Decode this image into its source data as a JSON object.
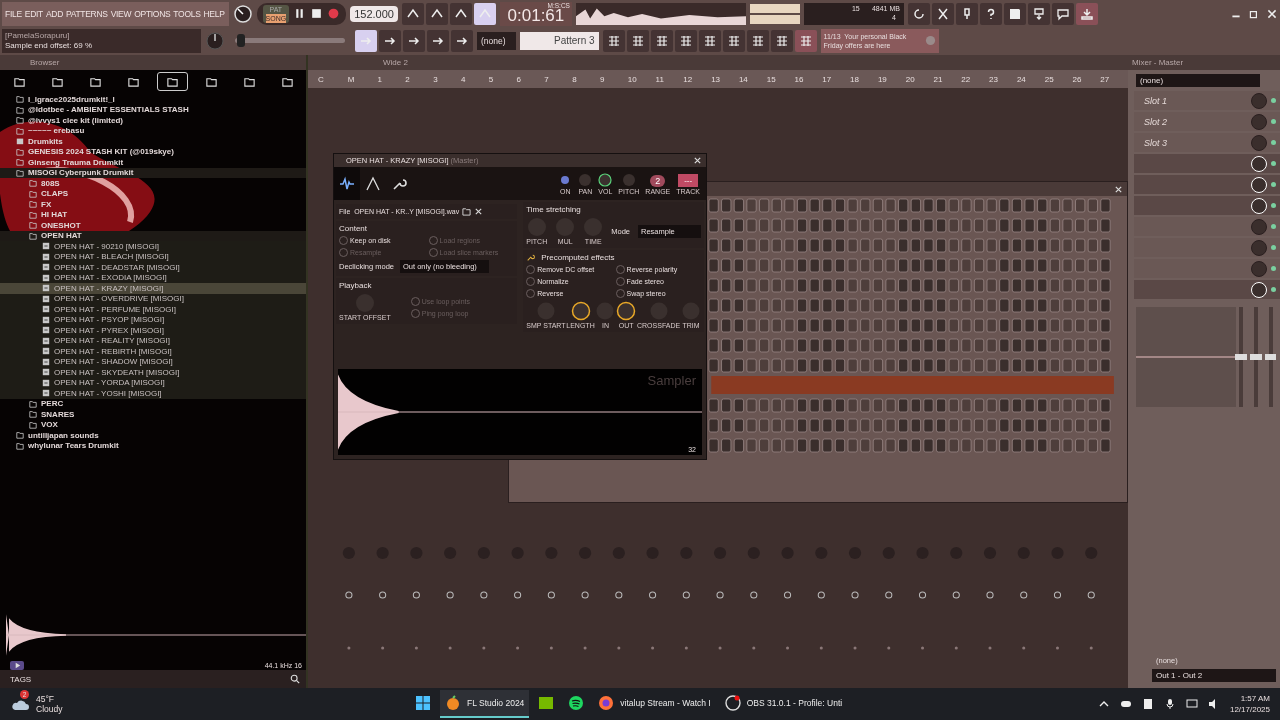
{
  "menu": [
    "FILE",
    "EDIT",
    "ADD",
    "PATTERNS",
    "VIEW",
    "OPTIONS",
    "TOOLS",
    "HELP"
  ],
  "hint_panel": {
    "title": "[PamelaSorapuru]",
    "text": "Sample end offset: 69 %"
  },
  "transport": {
    "pat_label": "PAT",
    "song_label": "SONG",
    "song_selected": true,
    "tempo": "152.000",
    "time": "0:01:61",
    "time_unit": "M:S:CS"
  },
  "position_slider": {
    "level": 0.02
  },
  "cpu": {
    "value": "15",
    "memory": "4841 MB",
    "polyphony": "4"
  },
  "pattern": {
    "preset": "(none)",
    "name": "Pattern 3"
  },
  "news": {
    "counter": "11/13",
    "text": "Your personal Black Friday offers are here"
  },
  "browser": {
    "title": "Browser",
    "tree": [
      {
        "kind": "folder",
        "label": "l_lgrace2025drumkit!_l",
        "expanded": false,
        "selected": false
      },
      {
        "kind": "folder",
        "label": "@ldotbee - AMBIENT ESSENTIALS STASH",
        "expanded": false,
        "selected": false
      },
      {
        "kind": "folder",
        "label": "@ivvys1 clee kit (limited)",
        "expanded": false,
        "selected": false
      },
      {
        "kind": "folder",
        "label": "~~~~~ erebasu",
        "expanded": false,
        "selected": false
      },
      {
        "kind": "pack",
        "label": "Drumkits",
        "expanded": false,
        "selected": false
      },
      {
        "kind": "folder",
        "label": "GENESIS 2024 STASH KIT (@019skye)",
        "expanded": false,
        "selected": false
      },
      {
        "kind": "folder",
        "label": "Ginseng Trauma Drumkit",
        "expanded": false,
        "selected": false
      },
      {
        "kind": "folder",
        "label": "MISOGI Cyberpunk Drumkit",
        "expanded": true,
        "selected": false,
        "children": [
          {
            "kind": "folder",
            "label": "808S",
            "expanded": false,
            "selected": false
          },
          {
            "kind": "folder",
            "label": "CLAPS",
            "expanded": false,
            "selected": false
          },
          {
            "kind": "folder",
            "label": "FX",
            "expanded": false,
            "selected": false
          },
          {
            "kind": "folder",
            "label": "HI HAT",
            "expanded": false,
            "selected": false
          },
          {
            "kind": "folder",
            "label": "ONESHOT",
            "expanded": false,
            "selected": false
          },
          {
            "kind": "folder",
            "label": "OPEN HAT",
            "expanded": true,
            "selected": false,
            "children": [
              {
                "kind": "file",
                "label": "OPEN HAT - 90210 [MISOGI]",
                "selected": false
              },
              {
                "kind": "file",
                "label": "OPEN HAT - BLEACH [MISOGI]",
                "selected": false
              },
              {
                "kind": "file",
                "label": "OPEN HAT - DEADSTAR [MISOGI]",
                "selected": false
              },
              {
                "kind": "file",
                "label": "OPEN HAT - EXODIA [MISOGI]",
                "selected": false
              },
              {
                "kind": "file",
                "label": "OPEN HAT - KRAZY [MISOGI]",
                "selected": true
              },
              {
                "kind": "file",
                "label": "OPEN HAT - OVERDRIVE [MISOGI]",
                "selected": false
              },
              {
                "kind": "file",
                "label": "OPEN HAT - PERFUME [MISOGI]",
                "selected": false
              },
              {
                "kind": "file",
                "label": "OPEN HAT - PSYOP [MISOGI]",
                "selected": false
              },
              {
                "kind": "file",
                "label": "OPEN HAT - PYREX [MISOGI]",
                "selected": false
              },
              {
                "kind": "file",
                "label": "OPEN HAT - REALITY [MISOGI]",
                "selected": false
              },
              {
                "kind": "file",
                "label": "OPEN HAT - REBIRTH [MISOGI]",
                "selected": false
              },
              {
                "kind": "file",
                "label": "OPEN HAT - SHADOW [MISOGI]",
                "selected": false
              },
              {
                "kind": "file",
                "label": "OPEN HAT - SKYDEATH [MISOGI]",
                "selected": false
              },
              {
                "kind": "file",
                "label": "OPEN HAT - YORDA [MISOGI]",
                "selected": false
              },
              {
                "kind": "file",
                "label": "OPEN HAT - YOSHI [MISOGI]",
                "selected": false
              }
            ]
          },
          {
            "kind": "folder",
            "label": "PERC",
            "expanded": false,
            "selected": false
          },
          {
            "kind": "folder",
            "label": "SNARES",
            "expanded": false,
            "selected": false
          },
          {
            "kind": "folder",
            "label": "VOX",
            "expanded": false,
            "selected": false
          }
        ]
      },
      {
        "kind": "folder",
        "label": "untilljapan sounds",
        "expanded": false,
        "selected": false
      },
      {
        "kind": "folder",
        "label": "whylunar Tears Drumkit",
        "expanded": false,
        "selected": false
      }
    ],
    "sample_info": "44.1 kHz 16",
    "tags_label": "TAGS"
  },
  "playlist": {
    "title": "Wide 2",
    "markers": [
      "C",
      "M"
    ],
    "bars": [
      "1",
      "2",
      "3",
      "4",
      "5",
      "6",
      "7",
      "8",
      "9",
      "10",
      "11",
      "12",
      "13",
      "14",
      "15",
      "16",
      "17",
      "18",
      "19",
      "20",
      "21",
      "22",
      "23",
      "24",
      "25",
      "26",
      "27"
    ]
  },
  "sampler": {
    "title": "OPEN HAT - KRAZY [MISOGI]",
    "subtitle": "(Master)",
    "tabs": [
      {
        "kind": "wave",
        "selected": true
      },
      {
        "kind": "envelope",
        "selected": false
      },
      {
        "kind": "wrench",
        "selected": false
      }
    ],
    "top_knobs": [
      {
        "label": "ON",
        "kind": "led"
      },
      {
        "label": "PAN",
        "kind": "knob"
      },
      {
        "label": "VOL",
        "kind": "ring"
      },
      {
        "label": "PITCH",
        "kind": "knob"
      }
    ],
    "range": {
      "label": "RANGE",
      "value": "2"
    },
    "track": {
      "label": "TRACK",
      "value": "---"
    },
    "file": {
      "label": "File",
      "name": "OPEN HAT - KR..Y [MISOGI].wav"
    },
    "content": {
      "title": "Content",
      "options": [
        {
          "label": "Keep on disk",
          "checked": false,
          "disabled": false
        },
        {
          "label": "Load regions",
          "checked": false,
          "disabled": true
        },
        {
          "label": "Resample",
          "checked": false,
          "disabled": true
        },
        {
          "label": "Load slice markers",
          "checked": false,
          "disabled": true
        }
      ],
      "declicking_label": "Declicking mode",
      "declicking_value": "Out only (no bleeding)"
    },
    "playback": {
      "title": "Playback",
      "knob": "START OFFSET",
      "options": [
        {
          "label": "Use loop points",
          "checked": false,
          "disabled": true
        },
        {
          "label": "Ping pong loop",
          "checked": false,
          "disabled": true
        }
      ]
    },
    "time_stretching": {
      "title": "Time stretching",
      "knobs": [
        "PITCH",
        "MUL",
        "TIME"
      ],
      "mode_label": "Mode",
      "mode_value": "Resample"
    },
    "effects": {
      "title": "Precomputed effects",
      "options": [
        {
          "label": "Remove DC offset",
          "checked": false
        },
        {
          "label": "Reverse polarity",
          "checked": false
        },
        {
          "label": "Normalize",
          "checked": false
        },
        {
          "label": "Fade stereo",
          "checked": false
        },
        {
          "label": "Reverse",
          "checked": false
        },
        {
          "label": "Swap stereo",
          "checked": false
        }
      ]
    },
    "envelope_knobs": [
      {
        "label": "SMP START",
        "active": false
      },
      {
        "label": "LENGTH",
        "active": true
      },
      {
        "label": "IN",
        "active": false
      },
      {
        "label": "OUT",
        "active": true
      },
      {
        "label": "CROSSFADE",
        "active": false
      },
      {
        "label": "TRIM",
        "active": false
      }
    ],
    "plugin_name": "Sampler",
    "zoom": "32"
  },
  "mixer": {
    "title": "Mixer - Master",
    "preset": "(none)",
    "slots": [
      {
        "label": "Slot 1",
        "active": false
      },
      {
        "label": "Slot 2",
        "active": false
      },
      {
        "label": "Slot 3",
        "active": false
      },
      {
        "active": true
      },
      {
        "active": true
      },
      {
        "active": true
      },
      {
        "active": false
      },
      {
        "active": false
      },
      {
        "active": false
      },
      {
        "active": true
      }
    ],
    "input": "(none)",
    "output": "Out 1 - Out 2"
  },
  "taskbar": {
    "weather": {
      "badge": "2",
      "temp": "45°F",
      "text": "Cloudy"
    },
    "apps": [
      {
        "kind": "windows",
        "active": false
      },
      {
        "kind": "fl",
        "label": "FL Studio 2024",
        "active": true
      },
      {
        "kind": "nvidia",
        "active": false
      },
      {
        "kind": "spotify",
        "active": false
      },
      {
        "kind": "firefox",
        "label": "vitalup Stream - Watch I",
        "active": false
      },
      {
        "kind": "obs",
        "label": "OBS 31.0.1 - Profile: Unti",
        "active": false
      }
    ],
    "time": "1:57 AM",
    "date": "12/17/2025"
  }
}
